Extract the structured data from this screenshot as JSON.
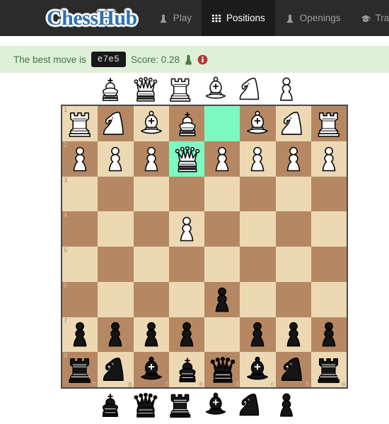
{
  "navbar": {
    "brand": "ChessHub",
    "items": [
      {
        "label": "Play",
        "icon": "pawn-icon",
        "active": false
      },
      {
        "label": "Positions",
        "icon": "grid-icon",
        "active": true
      },
      {
        "label": "Openings",
        "icon": "pawn-icon",
        "active": false
      },
      {
        "label": "Train",
        "icon": "graduation-cap-icon",
        "active": false
      }
    ]
  },
  "status": {
    "prefix": "The best move is",
    "move": "e7e5",
    "score_label": "Score: 0.28",
    "pawn_icon": "pawn-icon",
    "info_icon": "info-circle-icon",
    "bg_color": "#dff0d8",
    "text_color": "#3c763d",
    "badge_bg": "#181818"
  },
  "captured_top": {
    "color": "white",
    "pieces": [
      "king",
      "queen",
      "rook",
      "bishop",
      "knight",
      "pawn"
    ]
  },
  "captured_bottom": {
    "color": "black",
    "pieces": [
      "king",
      "queen",
      "rook",
      "bishop",
      "knight",
      "pawn"
    ]
  },
  "board": {
    "orientation": "black",
    "light_color": "#ecd9b4",
    "dark_color": "#b58863",
    "highlight_color": "#7dfac1",
    "files": [
      "h",
      "g",
      "f",
      "e",
      "d",
      "c",
      "b",
      "a"
    ],
    "ranks": [
      "1",
      "2",
      "3",
      "4",
      "5",
      "6",
      "7",
      "8"
    ],
    "rows": [
      {
        "rank": "1",
        "squares": [
          {
            "file": "h",
            "piece": "rook",
            "color": "white",
            "highlight": false
          },
          {
            "file": "g",
            "piece": "knight",
            "color": "white",
            "highlight": false
          },
          {
            "file": "f",
            "piece": "bishop",
            "color": "white",
            "highlight": false
          },
          {
            "file": "e",
            "piece": "king",
            "color": "white",
            "highlight": false
          },
          {
            "file": "d",
            "piece": null,
            "color": null,
            "highlight": true
          },
          {
            "file": "c",
            "piece": "bishop",
            "color": "white",
            "highlight": false
          },
          {
            "file": "b",
            "piece": "knight",
            "color": "white",
            "highlight": false
          },
          {
            "file": "a",
            "piece": "rook",
            "color": "white",
            "highlight": false
          }
        ]
      },
      {
        "rank": "2",
        "squares": [
          {
            "file": "h",
            "piece": "pawn",
            "color": "white",
            "highlight": false
          },
          {
            "file": "g",
            "piece": "pawn",
            "color": "white",
            "highlight": false
          },
          {
            "file": "f",
            "piece": "pawn",
            "color": "white",
            "highlight": false
          },
          {
            "file": "e",
            "piece": "queen",
            "color": "white",
            "highlight": true
          },
          {
            "file": "d",
            "piece": "pawn",
            "color": "white",
            "highlight": false
          },
          {
            "file": "c",
            "piece": "pawn",
            "color": "white",
            "highlight": false
          },
          {
            "file": "b",
            "piece": "pawn",
            "color": "white",
            "highlight": false
          },
          {
            "file": "a",
            "piece": "pawn",
            "color": "white",
            "highlight": false
          }
        ]
      },
      {
        "rank": "3",
        "squares": [
          {
            "file": "h",
            "piece": null,
            "color": null,
            "highlight": false
          },
          {
            "file": "g",
            "piece": null,
            "color": null,
            "highlight": false
          },
          {
            "file": "f",
            "piece": null,
            "color": null,
            "highlight": false
          },
          {
            "file": "e",
            "piece": null,
            "color": null,
            "highlight": false
          },
          {
            "file": "d",
            "piece": null,
            "color": null,
            "highlight": false
          },
          {
            "file": "c",
            "piece": null,
            "color": null,
            "highlight": false
          },
          {
            "file": "b",
            "piece": null,
            "color": null,
            "highlight": false
          },
          {
            "file": "a",
            "piece": null,
            "color": null,
            "highlight": false
          }
        ]
      },
      {
        "rank": "4",
        "squares": [
          {
            "file": "h",
            "piece": null,
            "color": null,
            "highlight": false
          },
          {
            "file": "g",
            "piece": null,
            "color": null,
            "highlight": false
          },
          {
            "file": "f",
            "piece": null,
            "color": null,
            "highlight": false
          },
          {
            "file": "e",
            "piece": "pawn",
            "color": "white",
            "highlight": false
          },
          {
            "file": "d",
            "piece": null,
            "color": null,
            "highlight": false
          },
          {
            "file": "c",
            "piece": null,
            "color": null,
            "highlight": false
          },
          {
            "file": "b",
            "piece": null,
            "color": null,
            "highlight": false
          },
          {
            "file": "a",
            "piece": null,
            "color": null,
            "highlight": false
          }
        ]
      },
      {
        "rank": "5",
        "squares": [
          {
            "file": "h",
            "piece": null,
            "color": null,
            "highlight": false
          },
          {
            "file": "g",
            "piece": null,
            "color": null,
            "highlight": false
          },
          {
            "file": "f",
            "piece": null,
            "color": null,
            "highlight": false
          },
          {
            "file": "e",
            "piece": null,
            "color": null,
            "highlight": false
          },
          {
            "file": "d",
            "piece": null,
            "color": null,
            "highlight": false
          },
          {
            "file": "c",
            "piece": null,
            "color": null,
            "highlight": false
          },
          {
            "file": "b",
            "piece": null,
            "color": null,
            "highlight": false
          },
          {
            "file": "a",
            "piece": null,
            "color": null,
            "highlight": false
          }
        ]
      },
      {
        "rank": "6",
        "squares": [
          {
            "file": "h",
            "piece": null,
            "color": null,
            "highlight": false
          },
          {
            "file": "g",
            "piece": null,
            "color": null,
            "highlight": false
          },
          {
            "file": "f",
            "piece": null,
            "color": null,
            "highlight": false
          },
          {
            "file": "e",
            "piece": null,
            "color": null,
            "highlight": false
          },
          {
            "file": "d",
            "piece": "pawn",
            "color": "black",
            "highlight": false
          },
          {
            "file": "c",
            "piece": null,
            "color": null,
            "highlight": false
          },
          {
            "file": "b",
            "piece": null,
            "color": null,
            "highlight": false
          },
          {
            "file": "a",
            "piece": null,
            "color": null,
            "highlight": false
          }
        ]
      },
      {
        "rank": "7",
        "squares": [
          {
            "file": "h",
            "piece": "pawn",
            "color": "black",
            "highlight": false
          },
          {
            "file": "g",
            "piece": "pawn",
            "color": "black",
            "highlight": false
          },
          {
            "file": "f",
            "piece": "pawn",
            "color": "black",
            "highlight": false
          },
          {
            "file": "e",
            "piece": "pawn",
            "color": "black",
            "highlight": false
          },
          {
            "file": "d",
            "piece": null,
            "color": null,
            "highlight": false
          },
          {
            "file": "c",
            "piece": "pawn",
            "color": "black",
            "highlight": false
          },
          {
            "file": "b",
            "piece": "pawn",
            "color": "black",
            "highlight": false
          },
          {
            "file": "a",
            "piece": "pawn",
            "color": "black",
            "highlight": false
          }
        ]
      },
      {
        "rank": "8",
        "squares": [
          {
            "file": "h",
            "piece": "rook",
            "color": "black",
            "highlight": false
          },
          {
            "file": "g",
            "piece": "knight",
            "color": "black",
            "highlight": false
          },
          {
            "file": "f",
            "piece": "bishop",
            "color": "black",
            "highlight": false
          },
          {
            "file": "e",
            "piece": "king",
            "color": "black",
            "highlight": false
          },
          {
            "file": "d",
            "piece": "queen",
            "color": "black",
            "highlight": false
          },
          {
            "file": "c",
            "piece": "bishop",
            "color": "black",
            "highlight": false
          },
          {
            "file": "b",
            "piece": "knight",
            "color": "black",
            "highlight": false
          },
          {
            "file": "a",
            "piece": "rook",
            "color": "black",
            "highlight": false
          }
        ]
      }
    ]
  }
}
